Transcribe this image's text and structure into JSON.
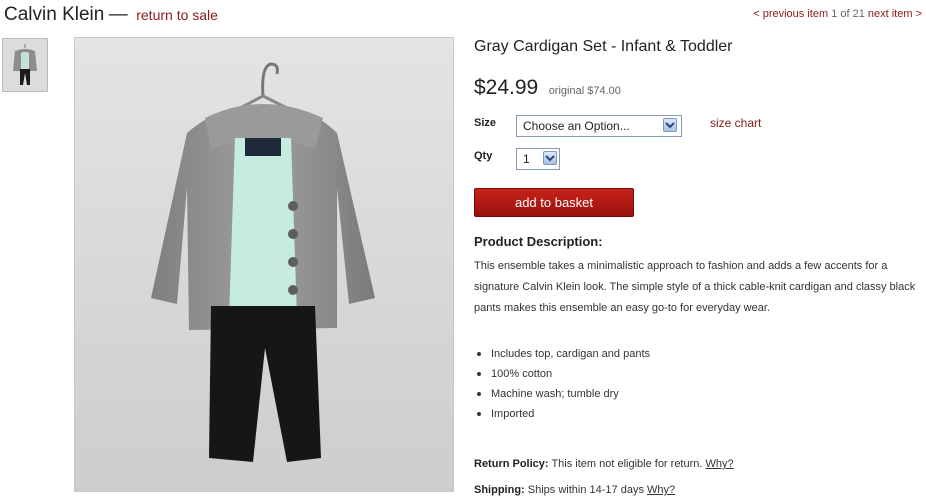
{
  "header": {
    "brand": "Calvin Klein",
    "separator": "—",
    "return_link": "return to sale"
  },
  "pager": {
    "prev_label": "< previous item",
    "position": "1 of 21",
    "next_label": "next item >"
  },
  "product": {
    "title": "Gray Cardigan Set - Infant & Toddler",
    "price": "$24.99",
    "original_price": "original $74.00",
    "size_label": "Size",
    "size_value": "Choose an Option...",
    "size_chart": "size chart",
    "qty_label": "Qty",
    "qty_value": "1",
    "add_button": "add to basket",
    "description_heading": "Product Description:",
    "description": "This ensemble takes a minimalistic approach to fashion and adds a few accents for a signature Calvin Klein look. The simple style of a thick cable-knit cardigan and classy black pants makes this ensemble an easy go-to for everyday wear.",
    "features": [
      "Includes top, cardigan and pants",
      "100% cotton",
      "Machine wash; tumble dry",
      "Imported"
    ],
    "return_policy_label": "Return Policy:",
    "return_policy_text": "This item not eligible for return.",
    "return_policy_why": "Why?",
    "shipping_label": "Shipping:",
    "shipping_text": "Ships within 14-17 days",
    "shipping_why": "Why?"
  },
  "colors": {
    "accent": "#8b1a1a",
    "button": "#b01a12"
  }
}
